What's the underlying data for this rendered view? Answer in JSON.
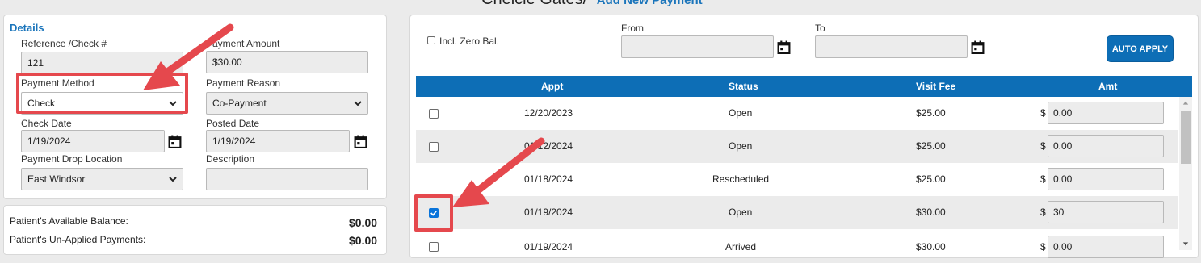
{
  "header": {
    "patient_name": "Cheicie Gates",
    "separator": "/",
    "add_link": "Add New Payment"
  },
  "details": {
    "title": "Details",
    "reference_label": "Reference /Check #",
    "reference_value": "121",
    "payment_amount_label": "Payment Amount",
    "payment_amount_value": "$30.00",
    "payment_method_label": "Payment Method",
    "payment_method_value": "Check",
    "payment_reason_label": "Payment Reason",
    "payment_reason_value": "Co-Payment",
    "check_date_label": "Check Date",
    "check_date_value": "1/19/2024",
    "posted_date_label": "Posted Date",
    "posted_date_value": "1/19/2024",
    "drop_location_label": "Payment Drop Location",
    "drop_location_value": "East Windsor",
    "description_label": "Description",
    "description_value": ""
  },
  "balances": {
    "available_label": "Patient's Available Balance:",
    "available_value": "$0.00",
    "unapplied_label": "Patient's Un-Applied Payments:",
    "unapplied_value": "$0.00"
  },
  "filters": {
    "incl_zero_label": "Incl. Zero Bal.",
    "from_label": "From",
    "from_value": "",
    "to_label": "To",
    "to_value": "",
    "auto_apply_label": "AUTO APPLY"
  },
  "table": {
    "columns": [
      "Appt",
      "Status",
      "Visit Fee",
      "Amt"
    ],
    "currency_symbol": "$",
    "rows": [
      {
        "appt": "12/20/2023",
        "status": "Open",
        "visit_fee": "$25.00",
        "amt": "0.00",
        "checked": false
      },
      {
        "appt": "01/12/2024",
        "status": "Open",
        "visit_fee": "$25.00",
        "amt": "0.00",
        "checked": false
      },
      {
        "appt": "01/18/2024",
        "status": "Rescheduled",
        "visit_fee": "$25.00",
        "amt": "0.00",
        "checked": false
      },
      {
        "appt": "01/19/2024",
        "status": "Open",
        "visit_fee": "$30.00",
        "amt": "30",
        "checked": true
      },
      {
        "appt": "01/19/2024",
        "status": "Arrived",
        "visit_fee": "$30.00",
        "amt": "0.00",
        "checked": false
      }
    ]
  },
  "colors": {
    "accent": "#1b75bb",
    "table_header": "#0d6eb6",
    "annotation": "#e5484d",
    "checkbox_checked": "#0a74da"
  }
}
